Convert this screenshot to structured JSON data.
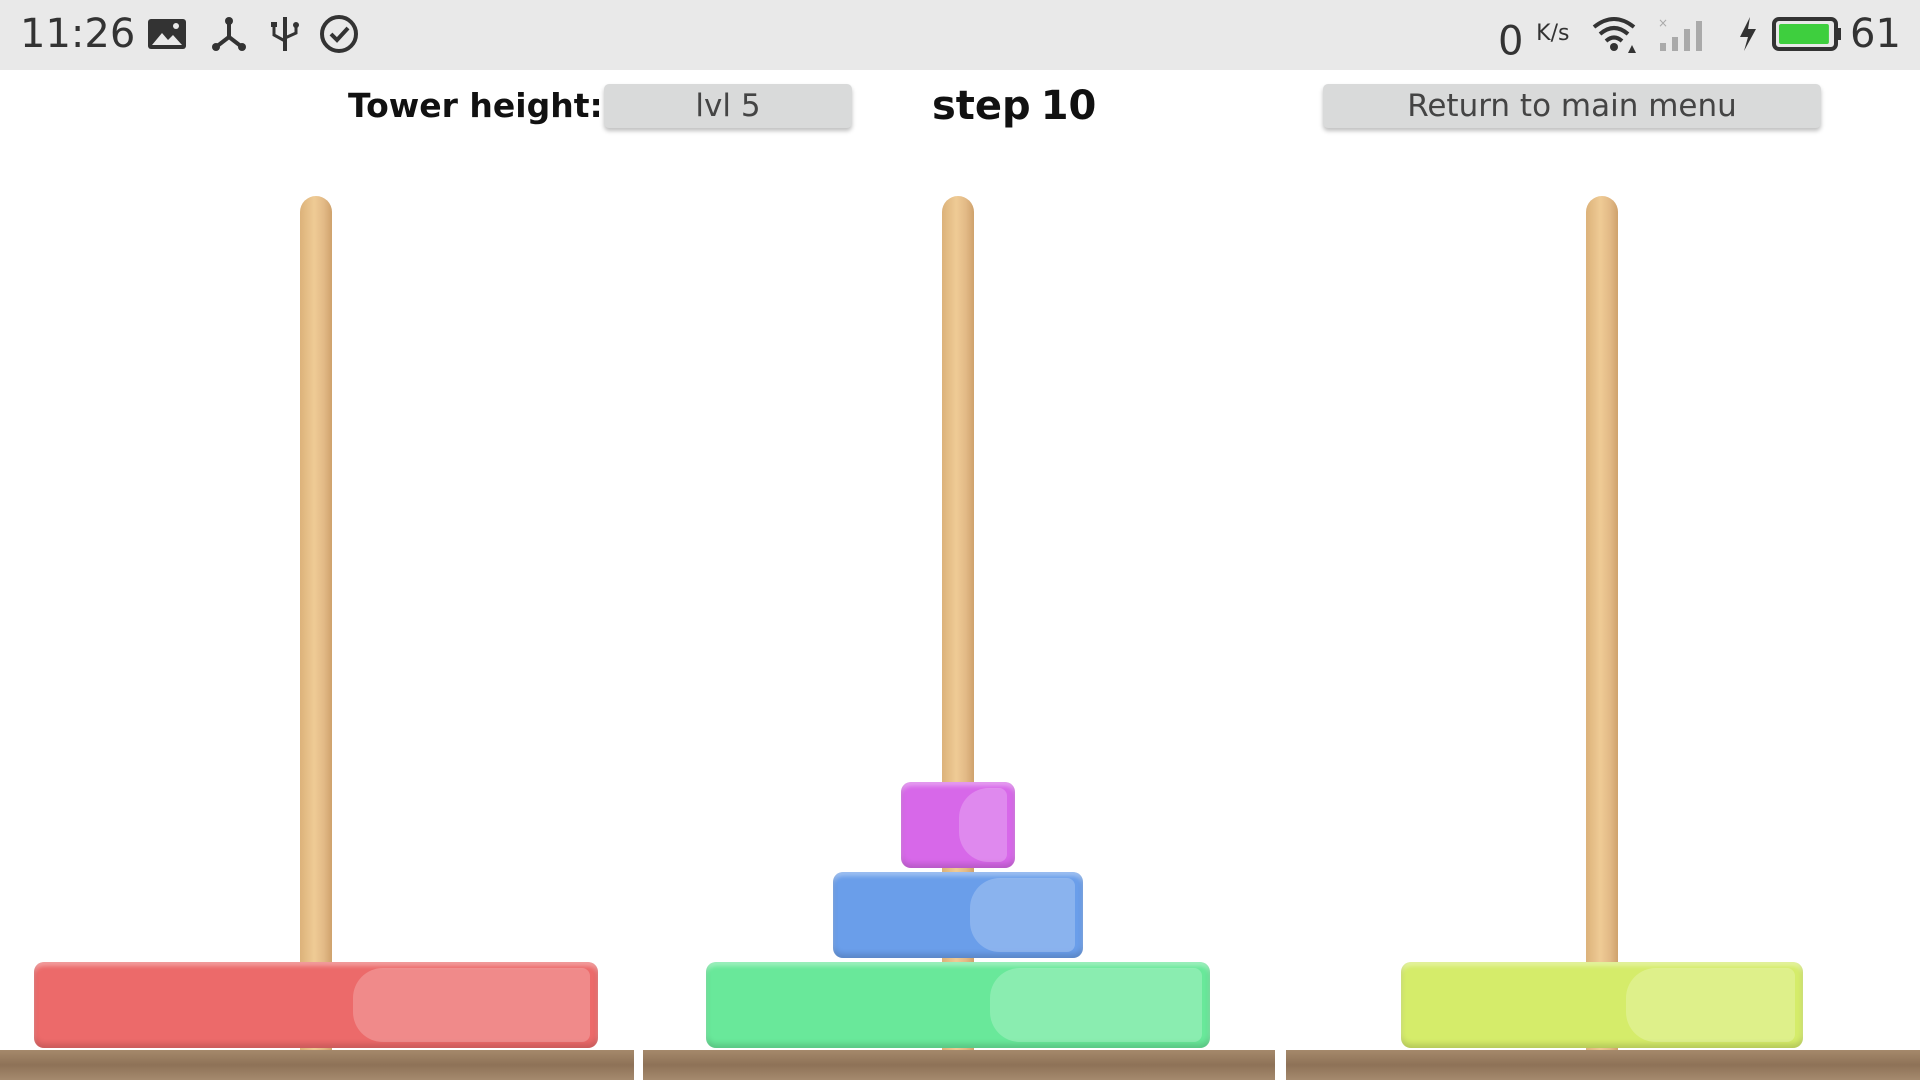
{
  "status_bar": {
    "time": "11:26",
    "icons": [
      "image-notification-icon",
      "share-notification-icon",
      "usb-icon",
      "check-circle-icon"
    ],
    "net_speed_value": "0",
    "net_speed_unit": "K/s",
    "right_icons": [
      "wifi-icon",
      "cellular-signal-icon",
      "charging-icon",
      "battery-icon"
    ],
    "battery_percent": "61"
  },
  "toolbar": {
    "tower_height_label": "Tower height:",
    "level_value": "lvl 5",
    "step_label": "step",
    "step_count": "10",
    "menu_button_label": "Return to main menu"
  },
  "game": {
    "rods": [
      {
        "name": "left",
        "disks": [
          {
            "size": 5,
            "color": "#ec6a6a"
          }
        ]
      },
      {
        "name": "middle",
        "disks": [
          {
            "size": 4,
            "color": "#69e89a"
          },
          {
            "size": 2,
            "color": "#6a9eea"
          },
          {
            "size": 1,
            "color": "#d768e9"
          }
        ]
      },
      {
        "name": "right",
        "disks": [
          {
            "size": 3,
            "color": "#d5ec6a"
          }
        ]
      }
    ],
    "colors": {
      "rod": "#e8c18b",
      "base": "#9b7f63"
    }
  }
}
